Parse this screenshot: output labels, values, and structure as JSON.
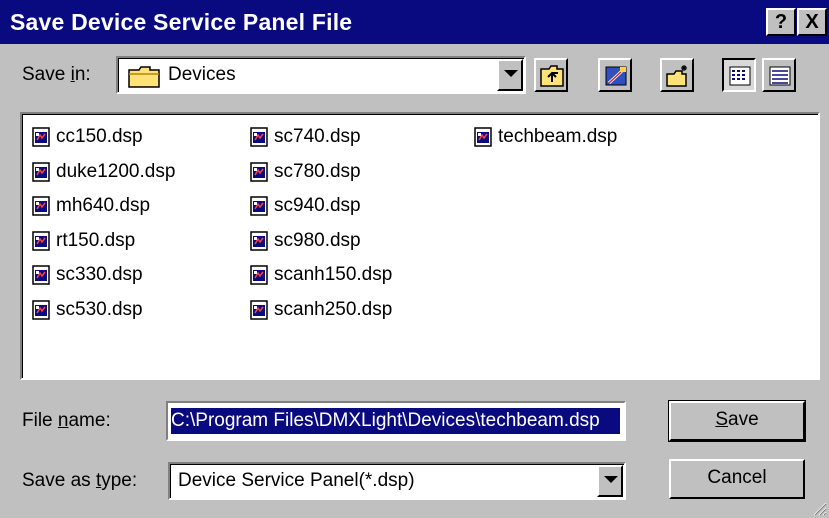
{
  "window": {
    "title": "Save Device Service Panel File",
    "help_label": "?",
    "close_label": "X"
  },
  "save_in": {
    "label_pre": "Save ",
    "label_key": "i",
    "label_post": "n:",
    "value": "Devices",
    "icon": "folder-icon"
  },
  "toolbar": {
    "icons": [
      "up-one-level-icon",
      "desktop-icon",
      "create-new-folder-icon",
      "list-view-icon",
      "details-view-icon"
    ]
  },
  "files": {
    "columns": [
      [
        "cc150.dsp",
        "duke1200.dsp",
        "mh640.dsp",
        "rt150.dsp",
        "sc330.dsp",
        "sc530.dsp"
      ],
      [
        "sc740.dsp",
        "sc780.dsp",
        "sc940.dsp",
        "sc980.dsp",
        "scanh150.dsp",
        "scanh250.dsp"
      ],
      [
        "techbeam.dsp"
      ]
    ]
  },
  "file_name": {
    "label_pre": "File ",
    "label_key": "n",
    "label_post": "ame:",
    "value": "C:\\Program Files\\DMXLight\\Devices\\techbeam.dsp"
  },
  "save_as_type": {
    "label_pre": "Save as ",
    "label_key": "t",
    "label_post": "ype:",
    "value": "Device Service Panel(*.dsp)"
  },
  "buttons": {
    "save_key": "S",
    "save_rest": "ave",
    "cancel": "Cancel"
  }
}
